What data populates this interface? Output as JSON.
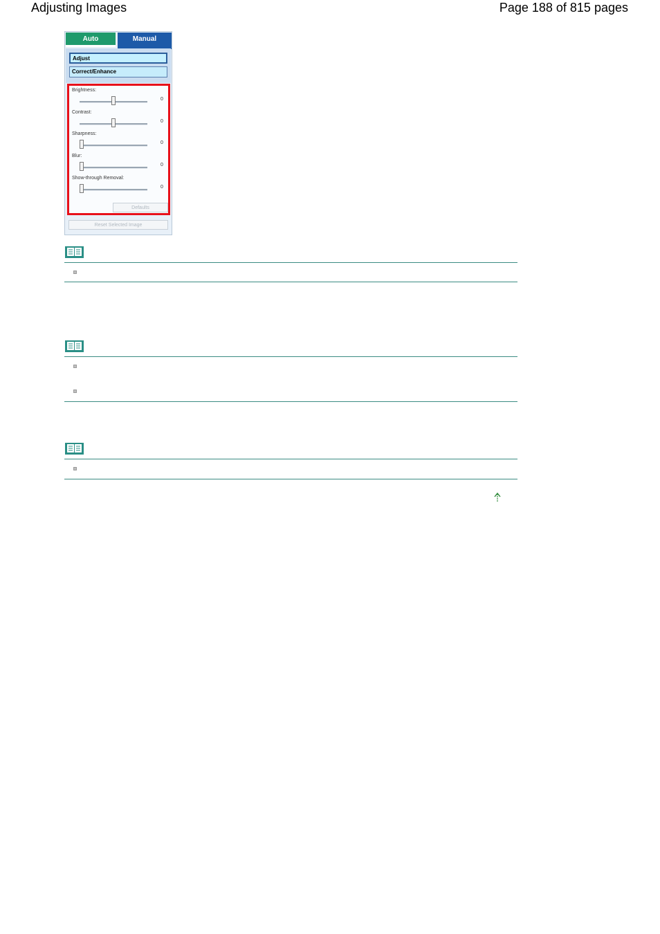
{
  "header": {
    "doc_title": "Adjusting Images",
    "page_count": "Page 188 of 815 pages"
  },
  "panel": {
    "tabs": {
      "auto": "Auto",
      "manual": "Manual"
    },
    "modes": {
      "adjust": "Adjust",
      "correct": "Correct/Enhance"
    },
    "sliders": [
      {
        "label": "Brightness:",
        "value": "0",
        "level": 0.5
      },
      {
        "label": "Contrast:",
        "value": "0",
        "level": 0.5
      },
      {
        "label": "Sharpness:",
        "value": "0",
        "level": 0.0
      },
      {
        "label": "Blur:",
        "value": "0",
        "level": 0.0
      },
      {
        "label": "Show-through Removal:",
        "value": "0",
        "level": 0.0
      }
    ],
    "defaults_label": "Defaults",
    "reset_label": "Reset Selected Image"
  },
  "colors": {
    "highlight": "#e8101a",
    "rule": "#3b8b82",
    "tab_auto": "#1f9a6c",
    "tab_manual": "#1d5aa8",
    "arrow": "#2e8b3a"
  },
  "icons": {
    "note": "note-book-icon",
    "bullet": "square-bullet-icon",
    "top": "up-arrow-icon"
  }
}
